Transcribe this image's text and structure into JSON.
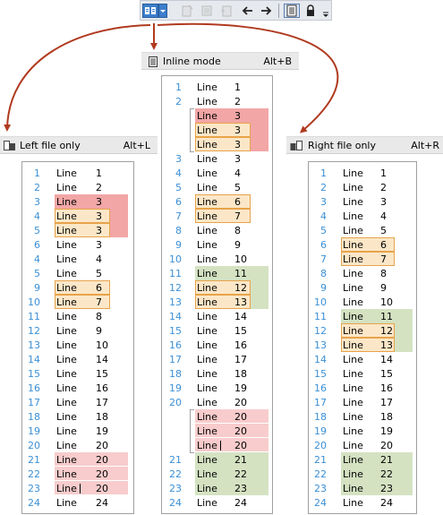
{
  "toolbar": {
    "buttons": [
      {
        "name": "view-mode-icon",
        "enabled": true
      },
      {
        "name": "dropdown-arrow-icon",
        "enabled": true
      },
      {
        "name": "tool-icon-1",
        "enabled": false
      },
      {
        "name": "tool-icon-2",
        "enabled": false
      },
      {
        "name": "tool-icon-3",
        "enabled": false
      },
      {
        "name": "arrow-left-icon",
        "enabled": true
      },
      {
        "name": "arrow-right-icon",
        "enabled": true
      },
      {
        "name": "document-list-icon",
        "enabled": true
      },
      {
        "name": "lock-icon",
        "enabled": true
      },
      {
        "name": "overflow-chevron-icon",
        "enabled": true
      }
    ]
  },
  "menu": {
    "inline": {
      "label": "Inline mode",
      "shortcut": "Alt+B",
      "icon": "inline-mode-icon"
    },
    "left": {
      "label": "Left file only",
      "shortcut": "Alt+L",
      "icon": "left-file-icon"
    },
    "right": {
      "label": "Right file only",
      "shortcut": "Alt+R",
      "icon": "right-file-icon"
    }
  },
  "line_word": "Line",
  "left_panel": {
    "rows": [
      {
        "ln": "1",
        "v": "1",
        "hl": ""
      },
      {
        "ln": "2",
        "v": "2",
        "hl": ""
      },
      {
        "ln": "3",
        "v": "3",
        "hl": "red"
      },
      {
        "ln": "4",
        "v": "3",
        "hl": "red",
        "mark": "orange"
      },
      {
        "ln": "5",
        "v": "3",
        "hl": "red",
        "mark": "orange"
      },
      {
        "ln": "6",
        "v": "3",
        "hl": ""
      },
      {
        "ln": "4",
        "v": "4",
        "hl": ""
      },
      {
        "ln": "5",
        "v": "5",
        "hl": ""
      },
      {
        "ln": "9",
        "v": "6",
        "hl": "",
        "mark": "orange"
      },
      {
        "ln": "10",
        "v": "7",
        "hl": "",
        "mark": "orange"
      },
      {
        "ln": "11",
        "v": "8",
        "hl": ""
      },
      {
        "ln": "12",
        "v": "9",
        "hl": ""
      },
      {
        "ln": "13",
        "v": "10",
        "hl": ""
      },
      {
        "ln": "14",
        "v": "14",
        "hl": ""
      },
      {
        "ln": "15",
        "v": "15",
        "hl": ""
      },
      {
        "ln": "16",
        "v": "16",
        "hl": ""
      },
      {
        "ln": "17",
        "v": "17",
        "hl": ""
      },
      {
        "ln": "18",
        "v": "18",
        "hl": ""
      },
      {
        "ln": "19",
        "v": "19",
        "hl": ""
      },
      {
        "ln": "20",
        "v": "20",
        "hl": ""
      },
      {
        "ln": "21",
        "v": "20",
        "hl": "redlt"
      },
      {
        "ln": "22",
        "v": "20",
        "hl": "redlt"
      },
      {
        "ln": "23",
        "v": "20",
        "hl": "redlt",
        "caret": true
      },
      {
        "ln": "24",
        "v": "24",
        "hl": ""
      }
    ]
  },
  "middle_panel": {
    "rows": [
      {
        "ln": "1",
        "v": "1",
        "hl": ""
      },
      {
        "ln": "2",
        "v": "2",
        "hl": ""
      },
      {
        "ln": "",
        "v": "3",
        "hl": "red"
      },
      {
        "ln": "",
        "v": "3",
        "hl": "red",
        "mark": "orange"
      },
      {
        "ln": "",
        "v": "3",
        "hl": "red",
        "mark": "orange"
      },
      {
        "ln": "3",
        "v": "3",
        "hl": ""
      },
      {
        "ln": "4",
        "v": "4",
        "hl": ""
      },
      {
        "ln": "5",
        "v": "5",
        "hl": ""
      },
      {
        "ln": "6",
        "v": "6",
        "hl": "",
        "mark": "orange"
      },
      {
        "ln": "7",
        "v": "7",
        "hl": "",
        "mark": "orange"
      },
      {
        "ln": "8",
        "v": "8",
        "hl": ""
      },
      {
        "ln": "9",
        "v": "9",
        "hl": ""
      },
      {
        "ln": "10",
        "v": "10",
        "hl": ""
      },
      {
        "ln": "11",
        "v": "11",
        "hl": "green"
      },
      {
        "ln": "12",
        "v": "12",
        "hl": "green",
        "mark": "orange"
      },
      {
        "ln": "13",
        "v": "13",
        "hl": "green",
        "mark": "orange"
      },
      {
        "ln": "14",
        "v": "14",
        "hl": ""
      },
      {
        "ln": "15",
        "v": "15",
        "hl": ""
      },
      {
        "ln": "16",
        "v": "16",
        "hl": ""
      },
      {
        "ln": "17",
        "v": "17",
        "hl": ""
      },
      {
        "ln": "18",
        "v": "18",
        "hl": ""
      },
      {
        "ln": "19",
        "v": "19",
        "hl": ""
      },
      {
        "ln": "20",
        "v": "20",
        "hl": ""
      },
      {
        "ln": "",
        "v": "20",
        "hl": "redlt"
      },
      {
        "ln": "",
        "v": "20",
        "hl": "redlt"
      },
      {
        "ln": "",
        "v": "20",
        "hl": "redlt",
        "caret": true
      },
      {
        "ln": "21",
        "v": "21",
        "hl": "green"
      },
      {
        "ln": "22",
        "v": "22",
        "hl": "green"
      },
      {
        "ln": "23",
        "v": "23",
        "hl": "green"
      },
      {
        "ln": "24",
        "v": "24",
        "hl": ""
      }
    ]
  },
  "right_panel": {
    "rows": [
      {
        "ln": "1",
        "v": "1",
        "hl": ""
      },
      {
        "ln": "2",
        "v": "2",
        "hl": ""
      },
      {
        "ln": "3",
        "v": "3",
        "hl": ""
      },
      {
        "ln": "4",
        "v": "4",
        "hl": ""
      },
      {
        "ln": "5",
        "v": "5",
        "hl": ""
      },
      {
        "ln": "6",
        "v": "6",
        "hl": "",
        "mark": "orange"
      },
      {
        "ln": "7",
        "v": "7",
        "hl": "",
        "mark": "orange"
      },
      {
        "ln": "8",
        "v": "8",
        "hl": ""
      },
      {
        "ln": "9",
        "v": "9",
        "hl": ""
      },
      {
        "ln": "10",
        "v": "10",
        "hl": ""
      },
      {
        "ln": "11",
        "v": "11",
        "hl": "green"
      },
      {
        "ln": "12",
        "v": "12",
        "hl": "green",
        "mark": "orange"
      },
      {
        "ln": "13",
        "v": "13",
        "hl": "green",
        "mark": "orange"
      },
      {
        "ln": "14",
        "v": "14",
        "hl": ""
      },
      {
        "ln": "15",
        "v": "15",
        "hl": ""
      },
      {
        "ln": "16",
        "v": "16",
        "hl": ""
      },
      {
        "ln": "17",
        "v": "17",
        "hl": ""
      },
      {
        "ln": "18",
        "v": "18",
        "hl": ""
      },
      {
        "ln": "19",
        "v": "19",
        "hl": ""
      },
      {
        "ln": "20",
        "v": "20",
        "hl": ""
      },
      {
        "ln": "21",
        "v": "21",
        "hl": "green"
      },
      {
        "ln": "22",
        "v": "22",
        "hl": "green"
      },
      {
        "ln": "23",
        "v": "23",
        "hl": "green"
      },
      {
        "ln": "24",
        "v": "24",
        "hl": ""
      }
    ]
  },
  "colors": {
    "line_number": "#3b8fd6",
    "deleted": "#f2a6a6",
    "deleted_light": "#f8cccc",
    "inserted": "#d4e2c2",
    "changed_fill": "#fbe7c8",
    "changed_border": "#e8a34a",
    "arrow": "#b03a1f"
  }
}
